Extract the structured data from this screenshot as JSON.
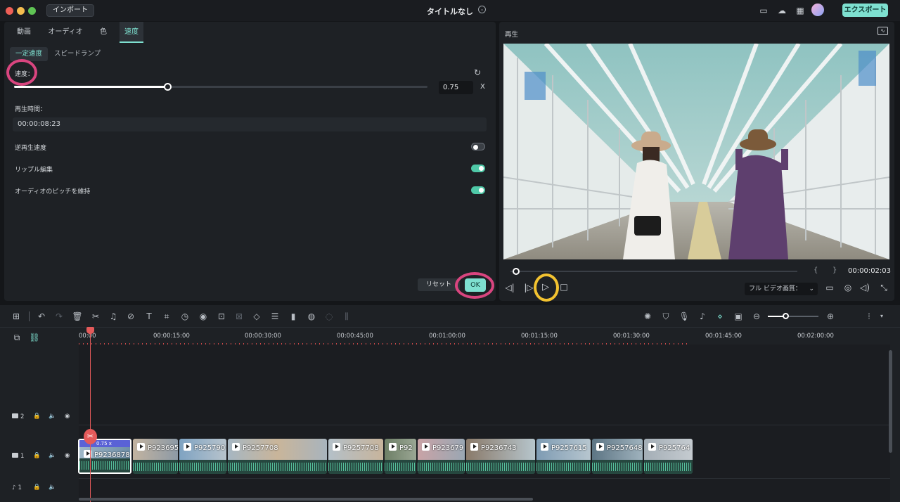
{
  "titlebar": {
    "import_label": "インポート",
    "title": "タイトルなし",
    "export_label": "エクスポート"
  },
  "tabs": [
    "動画",
    "オーディオ",
    "色",
    "速度"
  ],
  "subtabs": [
    "一定速度",
    "スピードランプ"
  ],
  "speed": {
    "label": "速度：",
    "value": "0.75",
    "unit": "X",
    "level": 0.36
  },
  "duration": {
    "label": "再生時間：",
    "value": "00:00:08:23"
  },
  "toggles": [
    {
      "label": "逆再生速度",
      "on": false
    },
    {
      "label": "リップル編集",
      "on": true
    },
    {
      "label": "オーディオのピッチを維持",
      "on": true
    }
  ],
  "buttons": {
    "reset": "リセット",
    "ok": "OK"
  },
  "player": {
    "title": "再生",
    "timecode": "00:00:02:03",
    "quality": "フル ビデオ画質：",
    "progress": 0.02,
    "mark_in": "{",
    "mark_out": "}"
  },
  "ruler": [
    "00:00",
    "00:00:15:00",
    "00:00:30:00",
    "00:00:45:00",
    "00:01:00:00",
    "00:01:15:00",
    "00:01:30:00",
    "00:01:45:00",
    "00:02:00:00"
  ],
  "tracks": {
    "v2": "2",
    "v1": "1",
    "a1": "1"
  },
  "clip_speed_badge": "0.75 x",
  "clips": [
    "P9236878",
    "P923695",
    "P925790",
    "P9257708",
    "P9257708",
    "P92",
    "P923679",
    "P9236743",
    "P9257615",
    "P9257648",
    "P925764"
  ]
}
